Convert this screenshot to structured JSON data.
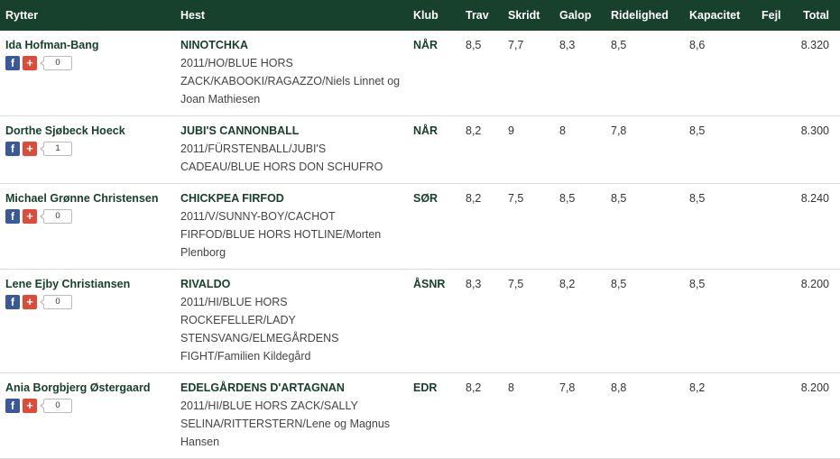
{
  "colors": {
    "header_bg": "#17402d",
    "accent_text": "#17402d",
    "facebook": "#3b5998",
    "google_plus": "#dd4b39"
  },
  "columns": [
    "Rytter",
    "Hest",
    "Klub",
    "Trav",
    "Skridt",
    "Galop",
    "Ridelighed",
    "Kapacitet",
    "Fejl",
    "Total"
  ],
  "share": {
    "facebook_glyph": "f",
    "gplus_glyph": "+"
  },
  "rows": [
    {
      "rider": "Ida Hofman-Bang",
      "share_count": "0",
      "horse": "NINOTCHKA",
      "horse_info": "2011/HO/BLUE HORS ZACK/KABOOKI/RAGAZZO/Niels Linnet og Joan Mathiesen",
      "club": "NÅR",
      "trav": "8,5",
      "skridt": "7,7",
      "galop": "8,3",
      "ridelighed": "8,5",
      "kapacitet": "8,6",
      "fejl": "",
      "total": "8.320"
    },
    {
      "rider": "Dorthe Sjøbeck Hoeck",
      "share_count": "1",
      "horse": "JUBI'S CANNONBALL",
      "horse_info": "2011/FÜRSTENBALL/JUBI'S CADEAU/BLUE HORS DON SCHUFRO",
      "club": "NÅR",
      "trav": "8,2",
      "skridt": "9",
      "galop": "8",
      "ridelighed": "7,8",
      "kapacitet": "8,5",
      "fejl": "",
      "total": "8.300"
    },
    {
      "rider": "Michael Grønne Christensen",
      "share_count": "0",
      "horse": "CHICKPEA FIRFOD",
      "horse_info": "2011/V/SUNNY-BOY/CACHOT FIRFOD/BLUE HORS HOTLINE/Morten Plenborg",
      "club": "SØR",
      "trav": "8,2",
      "skridt": "7,5",
      "galop": "8,5",
      "ridelighed": "8,5",
      "kapacitet": "8,5",
      "fejl": "",
      "total": "8.240"
    },
    {
      "rider": "Lene Ejby Christiansen",
      "share_count": "0",
      "horse": "RIVALDO",
      "horse_info": "2011/HI/BLUE HORS ROCKEFELLER/LADY STENSVANG/ELMEGÅRDENS FIGHT/Familien Kildegård",
      "club": "ÅSNR",
      "trav": "8,3",
      "skridt": "7,5",
      "galop": "8,2",
      "ridelighed": "8,5",
      "kapacitet": "8,5",
      "fejl": "",
      "total": "8.200"
    },
    {
      "rider": "Ania Borgbjerg Østergaard",
      "share_count": "0",
      "horse": "EDELGÅRDENS D'ARTAGNAN",
      "horse_info": "2011/HI/BLUE HORS ZACK/SALLY SELINA/RITTERSTERN/Lene og Magnus Hansen",
      "club": "EDR",
      "trav": "8,2",
      "skridt": "8",
      "galop": "7,8",
      "ridelighed": "8,8",
      "kapacitet": "8,2",
      "fejl": "",
      "total": "8.200"
    }
  ]
}
